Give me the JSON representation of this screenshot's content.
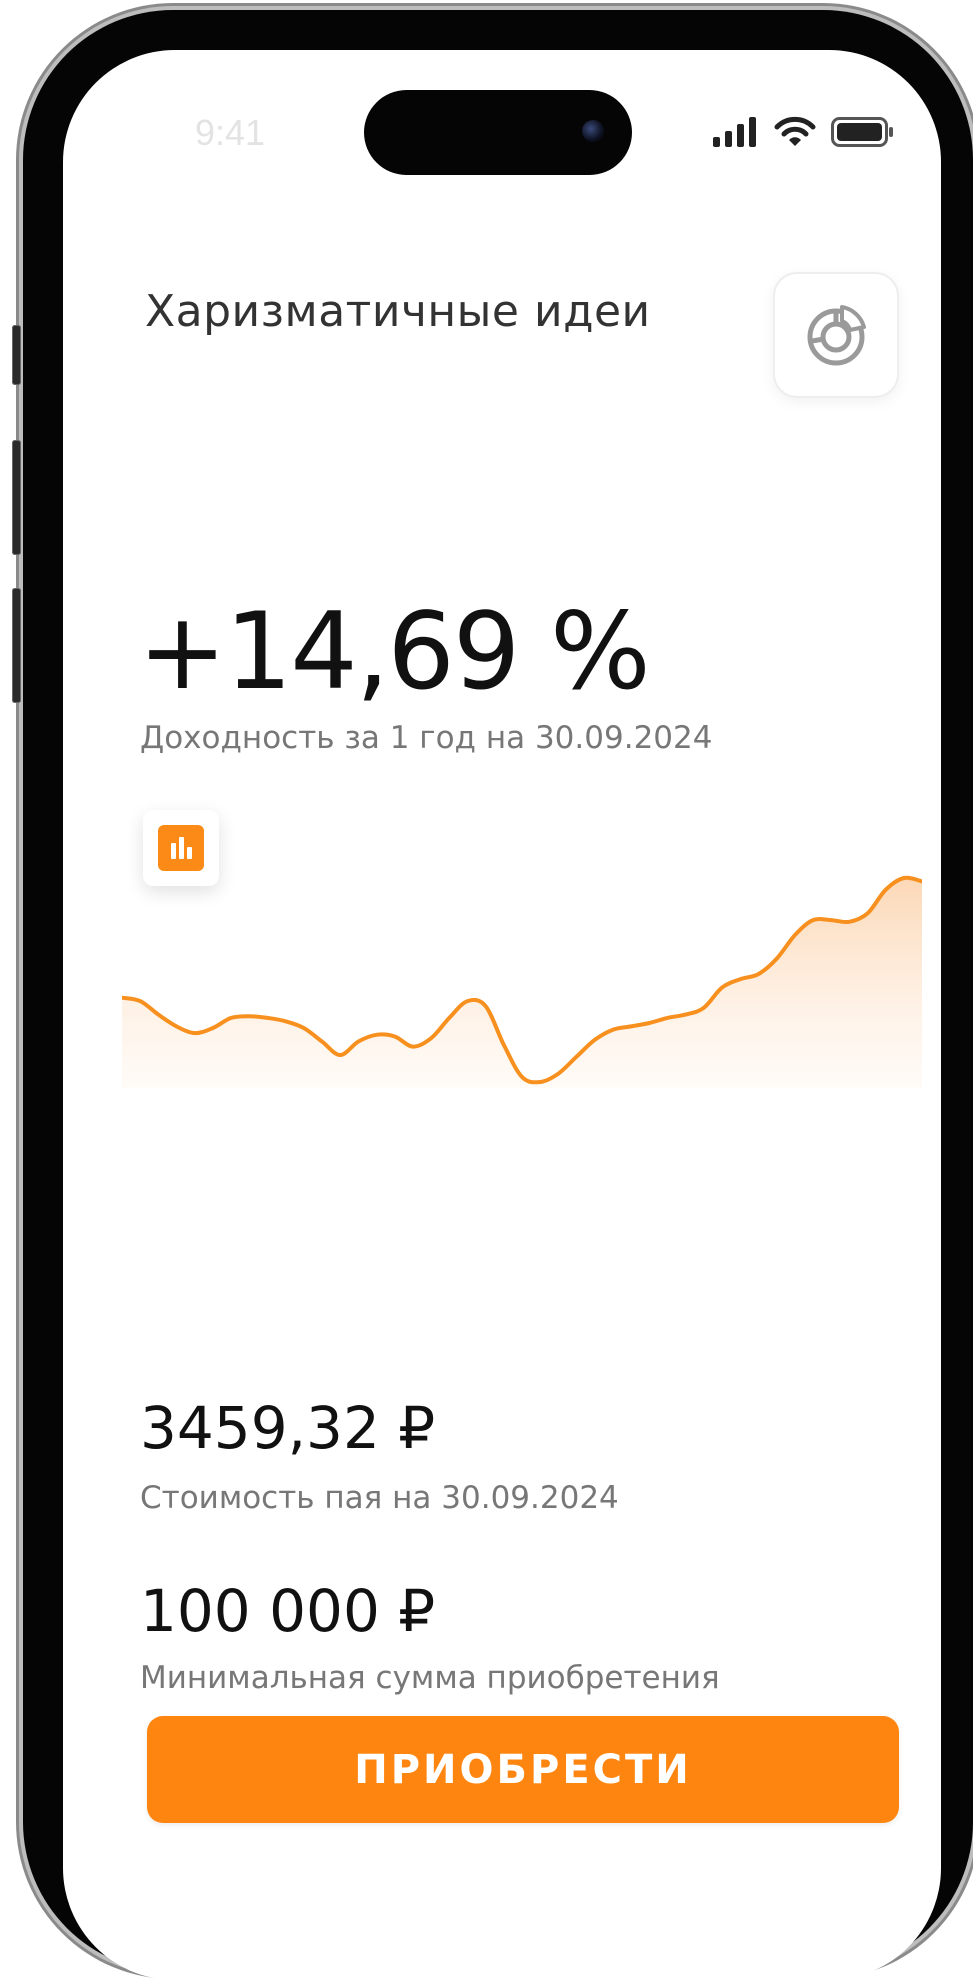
{
  "status_bar": {
    "time": "9:41",
    "icons": [
      "signal-icon",
      "wifi-icon",
      "battery-icon"
    ]
  },
  "header": {
    "title": "Харизматичные идеи",
    "chart_toggle_icon": "donut-chart-icon"
  },
  "yield": {
    "value": "+14,69 %",
    "caption": "Доходность за 1 год на 30.09.2024"
  },
  "chart": {
    "type_button_icon": "bar-chart-icon",
    "line_color": "#f7901e",
    "fill_color": "#fbdcc0"
  },
  "chart_data": {
    "type": "area",
    "series": [
      {
        "values": [
          50,
          48,
          40,
          33,
          29,
          32,
          38,
          39,
          38,
          36,
          32,
          24,
          16,
          24,
          28,
          27,
          21,
          26,
          38,
          48,
          45,
          22,
          3,
          0,
          5,
          15,
          25,
          31,
          33,
          35,
          38,
          40,
          44,
          56,
          61,
          64,
          73,
          87,
          96,
          96,
          95,
          100,
          114,
          121,
          119
        ]
      }
    ]
  },
  "unit_price": {
    "value": "3459,32 ₽",
    "caption": "Стоимость пая на 30.09.2024"
  },
  "min_amount": {
    "value": "100 000 ₽",
    "caption": "Минимальная сумма приобретения"
  },
  "buy_button": {
    "label": "ПРИОБРЕСТИ",
    "color": "#fd8510"
  }
}
